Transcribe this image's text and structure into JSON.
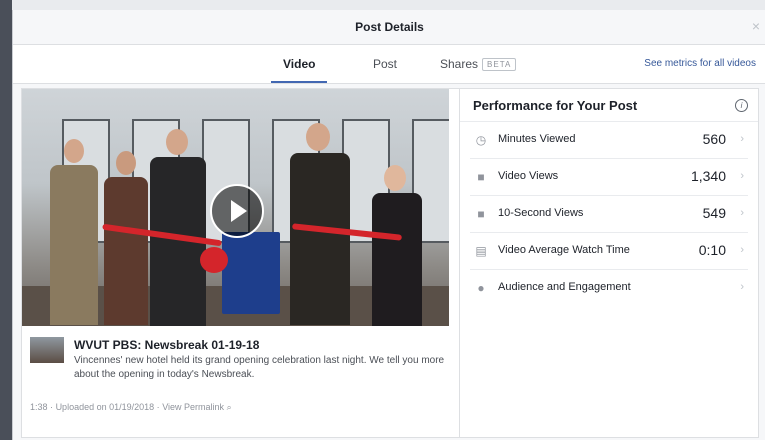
{
  "dialog": {
    "title": "Post Details",
    "close_label": "×"
  },
  "tabs": [
    {
      "label": "Video",
      "active": true
    },
    {
      "label": "Post",
      "active": false
    },
    {
      "label": "Shares",
      "badge": "BETA",
      "active": false
    }
  ],
  "see_metrics_link": "See metrics for all videos",
  "video": {
    "title": "WVUT PBS: Newsbreak 01-19-18",
    "description": "Vincennes' new hotel held its grand opening celebration last night. We tell you more about the opening in today's Newsbreak.",
    "duration": "1:38",
    "uploaded": "Uploaded on 01/19/2018",
    "permalink": "View Permalink",
    "separator": "·"
  },
  "performance": {
    "title": "Performance for Your Post",
    "metrics": [
      {
        "label": "Minutes Viewed",
        "value": "560",
        "icon": "clock-icon"
      },
      {
        "label": "Video Views",
        "value": "1,340",
        "icon": "video-camera-icon"
      },
      {
        "label": "10-Second Views",
        "value": "549",
        "icon": "video-camera-icon"
      },
      {
        "label": "Video Average Watch Time",
        "value": "0:10",
        "icon": "film-icon"
      },
      {
        "label": "Audience and Engagement",
        "value": "",
        "icon": "people-icon"
      }
    ]
  }
}
